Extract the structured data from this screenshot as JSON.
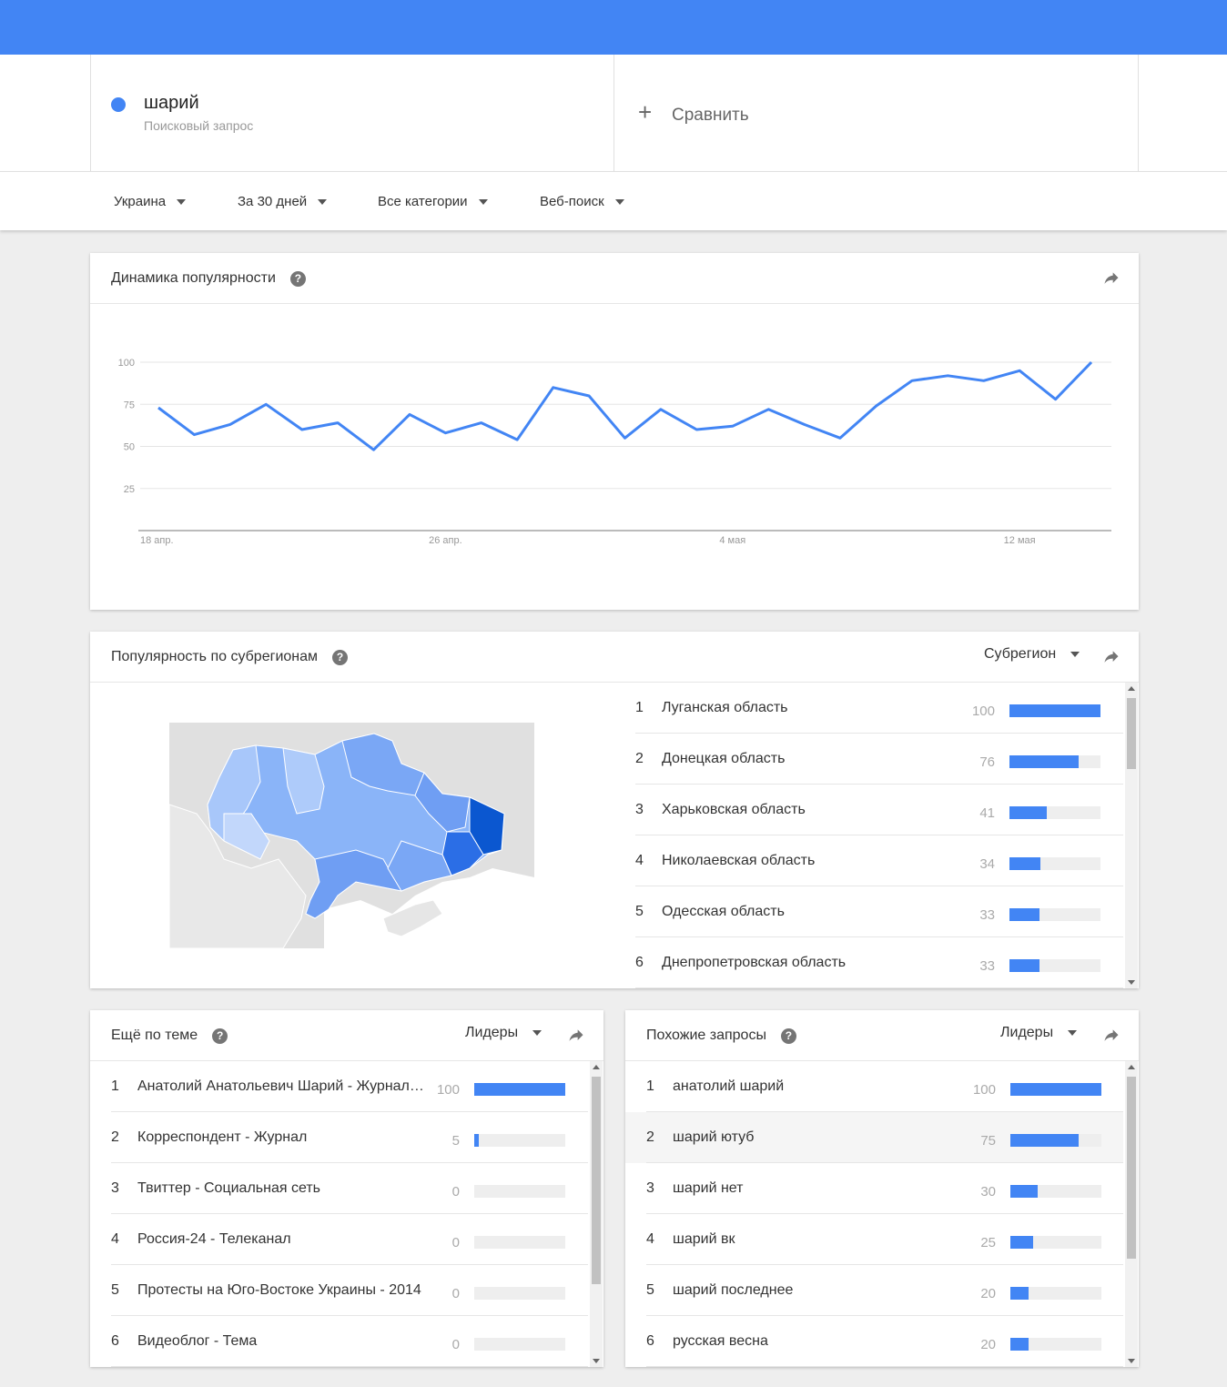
{
  "search": {
    "term": "шарий",
    "term_type": "Поисковый запрос",
    "compare_label": "Сравнить",
    "term_color": "#4285f4"
  },
  "filters": [
    {
      "label": "Украина"
    },
    {
      "label": "За 30 дней"
    },
    {
      "label": "Все категории"
    },
    {
      "label": "Веб-поиск"
    }
  ],
  "trend": {
    "title": "Динамика популярности",
    "help": "?",
    "chart_data": {
      "type": "line",
      "title": "Динамика популярности",
      "y_ticks": [
        "100",
        "75",
        "50",
        "25"
      ],
      "x_ticks": [
        {
          "label": "18 апр.",
          "index": 0
        },
        {
          "label": "26 апр.",
          "index": 8
        },
        {
          "label": "4 мая",
          "index": 16
        },
        {
          "label": "12 мая",
          "index": 24
        }
      ],
      "ylim": [
        0,
        100
      ],
      "grid": true,
      "series": [
        {
          "values": [
            73,
            57,
            63,
            75,
            60,
            64,
            48,
            69,
            58,
            64,
            54,
            85,
            80,
            55,
            72,
            60,
            62,
            72,
            63,
            55,
            74,
            89,
            92,
            89,
            95,
            78,
            100
          ],
          "color": "#4285f4"
        }
      ]
    }
  },
  "regions": {
    "title": "Популярность по субрегионам",
    "help": "?",
    "select_label": "Субрегион",
    "items": [
      {
        "rank": "1",
        "name": "Луганская область",
        "value": "100",
        "pct": 100
      },
      {
        "rank": "2",
        "name": "Донецкая область",
        "value": "76",
        "pct": 76
      },
      {
        "rank": "3",
        "name": "Харьковская область",
        "value": "41",
        "pct": 41
      },
      {
        "rank": "4",
        "name": "Николаевская область",
        "value": "34",
        "pct": 34
      },
      {
        "rank": "5",
        "name": "Одесская область",
        "value": "33",
        "pct": 33
      },
      {
        "rank": "6",
        "name": "Днепропетровская область",
        "value": "33",
        "pct": 33
      }
    ]
  },
  "topics": {
    "title": "Ещё по теме",
    "help": "?",
    "select_label": "Лидеры",
    "items": [
      {
        "rank": "1",
        "name": "Анатолий Анатольевич Шарий - Журналист",
        "value": "100",
        "pct": 100
      },
      {
        "rank": "2",
        "name": "Корреспондент - Журнал",
        "value": "5",
        "pct": 5
      },
      {
        "rank": "3",
        "name": "Твиттер - Социальная сеть",
        "value": "0",
        "pct": 0
      },
      {
        "rank": "4",
        "name": "Россия-24 - Телеканал",
        "value": "0",
        "pct": 0
      },
      {
        "rank": "5",
        "name": "Протесты на Юго-Востоке Украины - 2014",
        "value": "0",
        "pct": 0
      },
      {
        "rank": "6",
        "name": "Видеоблог - Тема",
        "value": "0",
        "pct": 0
      }
    ]
  },
  "queries": {
    "title": "Похожие запросы",
    "help": "?",
    "select_label": "Лидеры",
    "items": [
      {
        "rank": "1",
        "name": "анатолий шарий",
        "value": "100",
        "pct": 100
      },
      {
        "rank": "2",
        "name": "шарий ютуб",
        "value": "75",
        "pct": 75
      },
      {
        "rank": "3",
        "name": "шарий нет",
        "value": "30",
        "pct": 30
      },
      {
        "rank": "4",
        "name": "шарий вк",
        "value": "25",
        "pct": 25
      },
      {
        "rank": "5",
        "name": "шарий последнее",
        "value": "20",
        "pct": 20
      },
      {
        "rank": "6",
        "name": "русская весна",
        "value": "20",
        "pct": 20
      }
    ]
  },
  "icons": {
    "share": "share-icon",
    "help": "help-icon",
    "caret": "caret-down-icon",
    "plus": "plus-icon"
  },
  "colors": {
    "accent": "#4285f4",
    "bar_track": "#eeeeee"
  }
}
